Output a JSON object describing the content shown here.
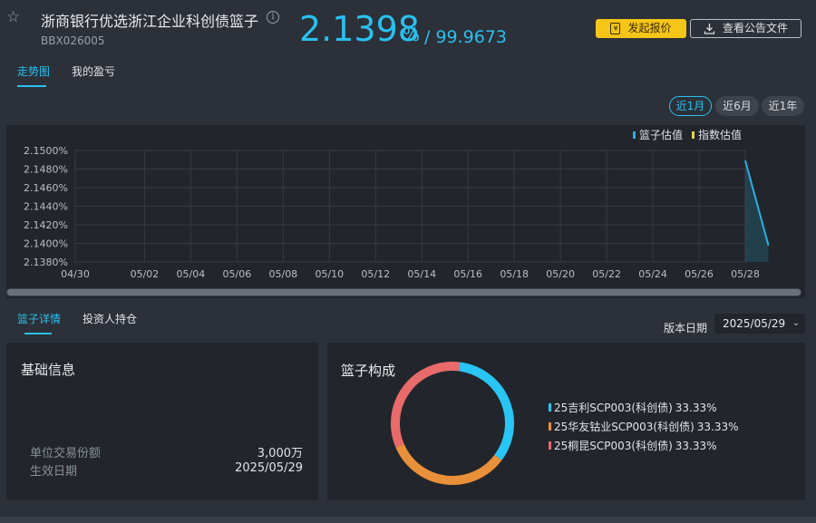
{
  "header": {
    "star_glyph": "☆",
    "title": "浙商银行优选浙江企业科创债篮子",
    "info_glyph": "i",
    "code": "BBX026005",
    "rate": "2.1398",
    "rate_unit": "%",
    "price": "/ 99.9673",
    "quote_button": "发起报价",
    "doc_button": "查看公告文件",
    "quote_icon": "yen-doc-icon",
    "doc_icon": "download-icon"
  },
  "top_tabs": [
    {
      "label": "走势图",
      "active": true
    },
    {
      "label": "我的盈亏",
      "active": false
    }
  ],
  "ranges": [
    {
      "label": "近1月",
      "active": true
    },
    {
      "label": "近6月",
      "active": false
    },
    {
      "label": "近1年",
      "active": false
    }
  ],
  "chart_data": {
    "type": "line",
    "legend": [
      {
        "name": "篮子估值",
        "color": "#29b0e0"
      },
      {
        "name": "指数估值",
        "color": "#e8d44d"
      }
    ],
    "legend_position": "top-right",
    "x_ticks": [
      "04/30",
      "05/02",
      "05/04",
      "05/06",
      "05/08",
      "05/10",
      "05/12",
      "05/14",
      "05/16",
      "05/18",
      "05/20",
      "05/22",
      "05/24",
      "05/26",
      "05/28"
    ],
    "y_ticks": [
      "2.1380%",
      "2.1400%",
      "2.1420%",
      "2.1440%",
      "2.1460%",
      "2.1480%",
      "2.1500%"
    ],
    "ylim": [
      2.138,
      2.15
    ],
    "xlim": [
      "04/30",
      "05/29"
    ],
    "grid": true,
    "series": [
      {
        "name": "篮子估值",
        "points": [
          [
            "05/28",
            2.1489
          ],
          [
            "05/29",
            2.1398
          ]
        ]
      }
    ]
  },
  "lower_tabs": [
    {
      "label": "篮子详情",
      "active": true
    },
    {
      "label": "投资人持仓",
      "active": false
    }
  ],
  "version": {
    "label": "版本日期",
    "value": "2025/05/29",
    "chevron": "⌄"
  },
  "basic_info": {
    "title": "基础信息",
    "rows": [
      {
        "label": "单位交易份额",
        "value": "3,000万"
      },
      {
        "label": "生效日期",
        "value": "2025/05/29"
      }
    ]
  },
  "composition": {
    "title": "篮子构成",
    "items": [
      {
        "name": "25吉利SCP003(科创债)",
        "pct": "33.33%",
        "share": 33.33,
        "color": "#29c5f5"
      },
      {
        "name": "25华友钴业SCP003(科创债)",
        "pct": "33.33%",
        "share": 33.33,
        "color": "#e8903a"
      },
      {
        "name": "25桐昆SCP003(科创债)",
        "pct": "33.33%",
        "share": 33.33,
        "color": "#e86a6a"
      }
    ]
  }
}
